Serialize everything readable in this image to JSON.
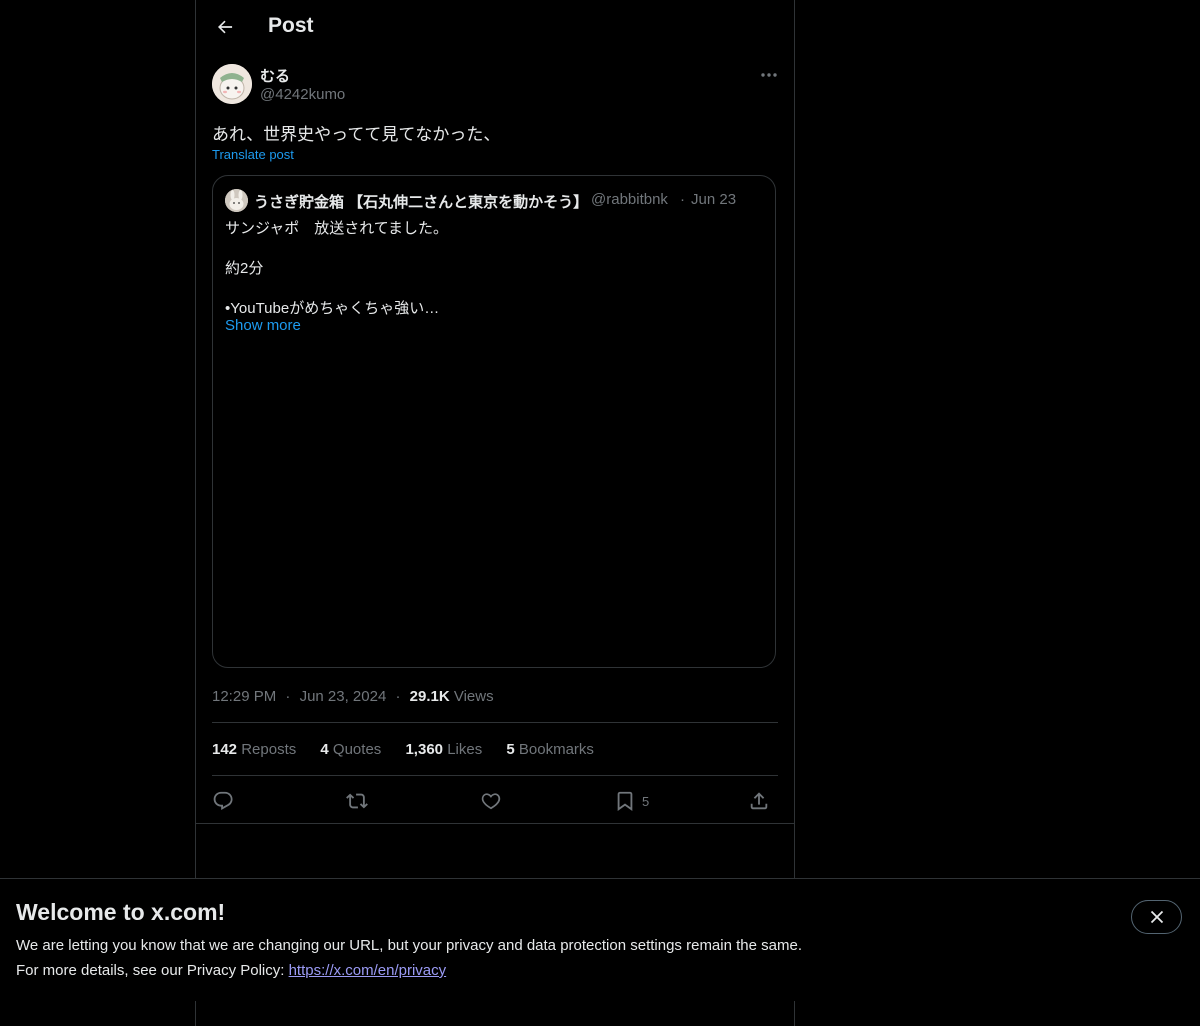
{
  "header": {
    "title": "Post",
    "back_icon": "arrow-left-icon"
  },
  "tweet": {
    "author_name": "むる",
    "author_handle": "@4242kumo",
    "text": "あれ、世界史やってて見てなかった、",
    "translate_label": "Translate post",
    "more_icon": "more-horizontal-icon"
  },
  "quote": {
    "author_name": "うさぎ貯金箱 【石丸伸二さんと東京を動かそう】",
    "author_handle": "@rabbitbnk",
    "separator": "·",
    "date": "Jun 23",
    "lines": [
      "サンジャポ　放送されてました。",
      "約2分",
      "•YouTubeがめちゃくちゃ強い…"
    ],
    "show_more": "Show more"
  },
  "meta": {
    "time": "12:29 PM",
    "sep1": "·",
    "date": "Jun 23, 2024",
    "sep2": "·",
    "views_count": "29.1K",
    "views_label": "Views"
  },
  "stats": {
    "reposts_count": "142",
    "reposts_label": "Repos­ts",
    "quotes_count": "4",
    "quotes_label": "Quotes",
    "likes_count": "1,360",
    "likes_label": "Likes",
    "bookmarks_count": "5",
    "bookmarks_label": "Bookmarks"
  },
  "actions": {
    "reply_icon": "reply-icon",
    "repost_icon": "repost-icon",
    "like_icon": "heart-icon",
    "bookmark_icon": "bookmark-icon",
    "bookmark_count": "5",
    "share_icon": "share-icon"
  },
  "banner": {
    "title": "Welcome to x.com!",
    "line1": "We are letting you know that we are changing our URL, but your privacy and data protection settings remain the same.",
    "line2_prefix": "For more details, see our Privacy Policy: ",
    "link": "https://x.com/en/privacy",
    "close_icon": "close-icon"
  },
  "colors": {
    "background": "#000000",
    "accent": "#1d9bf0",
    "muted": "#71767b",
    "border": "#2f3336"
  }
}
